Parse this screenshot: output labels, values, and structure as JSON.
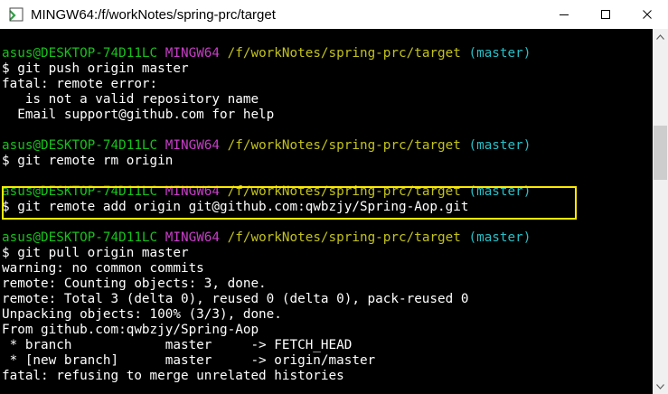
{
  "window": {
    "title": "MINGW64:/f/workNotes/spring-prc/target",
    "icon": "git-bash-icon"
  },
  "controls": {
    "minimize": "minimize-icon",
    "maximize": "maximize-icon",
    "close": "close-icon"
  },
  "colors": {
    "user": "#17c11c",
    "env": "#c83dc8",
    "path": "#c3c31c",
    "branch": "#27bfc7",
    "highlight": "#ffea00",
    "background": "#000000",
    "text": "#ffffff"
  },
  "prompt": {
    "user": "asus@DESKTOP-74D11LC",
    "env": "MINGW64",
    "path": "/f/workNotes/spring-prc/target",
    "branch": "(master)"
  },
  "lines": {
    "l01": "$ git push origin master",
    "l02": "fatal: remote error:",
    "l03": "   is not a valid repository name",
    "l04": "  Email support@github.com for help",
    "l06": "$ git remote rm origin",
    "l08": "$ git remote add origin git@github.com:qwbzjy/Spring-Aop.git",
    "l10": "$ git pull origin master",
    "l11": "warning: no common commits",
    "l12": "remote: Counting objects: 3, done.",
    "l13": "remote: Total 3 (delta 0), reused 0 (delta 0), pack-reused 0",
    "l14": "Unpacking objects: 100% (3/3), done.",
    "l15": "From github.com:qwbzjy/Spring-Aop",
    "l16": " * branch            master     -> FETCH_HEAD",
    "l17": " * [new branch]      master     -> origin/master",
    "l18": "fatal: refusing to merge unrelated histories"
  }
}
